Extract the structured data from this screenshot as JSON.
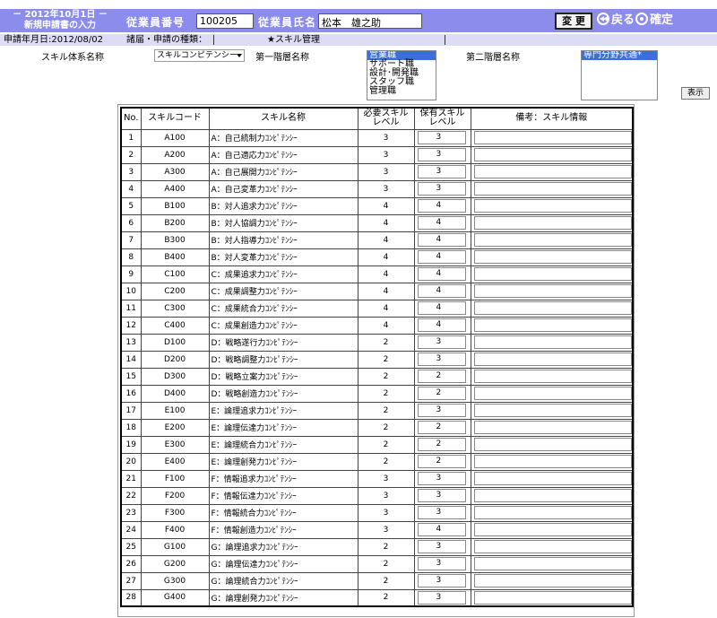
{
  "header": {
    "date": "－ 2012年10月1日 －",
    "screen_title": "新規申請書の入力",
    "employee_no_label": "従業員番号",
    "employee_no_value": "100205",
    "employee_name_label": "従業員氏名",
    "employee_name_value": "松本　雄之助",
    "change_button": "変 更",
    "back_label": "戻る",
    "confirm_label": "確定"
  },
  "subbar": {
    "apply_date": "申請年月日:2012/08/02",
    "type_label": "諸届・申請の種類：",
    "type_value": "★スキル管理"
  },
  "filters": {
    "system_label": "スキル体系名称",
    "system_selected": "スキルコンピテンシー",
    "level1_label": "第一階層名称",
    "level1_options": [
      "営業職",
      "サポート職",
      "設計･開発職",
      "スタッフ職",
      "管理職"
    ],
    "level2_label": "第二階層名称",
    "level2_options": [
      "専門分野共通*"
    ],
    "show_button": "表示"
  },
  "table": {
    "headers": {
      "no": "No.",
      "code": "スキルコード",
      "name": "スキル名称",
      "required_l1": "必要スキル",
      "required_l2": "レベル",
      "held_l1": "保有スキル",
      "held_l2": "レベル",
      "note": "備考：スキル情報"
    },
    "rows": [
      {
        "no": "1",
        "code": "A100",
        "name": "A：自己統制力ｺﾝﾋﾟﾃﾝｼｰ",
        "req": "3",
        "held": "3"
      },
      {
        "no": "2",
        "code": "A200",
        "name": "A：自己適応力ｺﾝﾋﾟﾃﾝｼｰ",
        "req": "3",
        "held": "3"
      },
      {
        "no": "3",
        "code": "A300",
        "name": "A：自己展開力ｺﾝﾋﾟﾃﾝｼｰ",
        "req": "3",
        "held": "3"
      },
      {
        "no": "4",
        "code": "A400",
        "name": "A：自己変革力ｺﾝﾋﾟﾃﾝｼｰ",
        "req": "3",
        "held": "3"
      },
      {
        "no": "5",
        "code": "B100",
        "name": "B：対人追求力ｺﾝﾋﾟﾃﾝｼｰ",
        "req": "4",
        "held": "4"
      },
      {
        "no": "6",
        "code": "B200",
        "name": "B：対人協調力ｺﾝﾋﾟﾃﾝｼｰ",
        "req": "4",
        "held": "4"
      },
      {
        "no": "7",
        "code": "B300",
        "name": "B：対人指導力ｺﾝﾋﾟﾃﾝｼｰ",
        "req": "4",
        "held": "4"
      },
      {
        "no": "8",
        "code": "B400",
        "name": "B：対人変革力ｺﾝﾋﾟﾃﾝｼｰ",
        "req": "4",
        "held": "4"
      },
      {
        "no": "9",
        "code": "C100",
        "name": "C：成果追求力ｺﾝﾋﾟﾃﾝｼｰ",
        "req": "4",
        "held": "4"
      },
      {
        "no": "10",
        "code": "C200",
        "name": "C：成果調整力ｺﾝﾋﾟﾃﾝｼｰ",
        "req": "4",
        "held": "4"
      },
      {
        "no": "11",
        "code": "C300",
        "name": "C：成果統合力ｺﾝﾋﾟﾃﾝｼｰ",
        "req": "4",
        "held": "4"
      },
      {
        "no": "12",
        "code": "C400",
        "name": "C：成果創造力ｺﾝﾋﾟﾃﾝｼｰ",
        "req": "4",
        "held": "4"
      },
      {
        "no": "13",
        "code": "D100",
        "name": "D：戦略遂行力ｺﾝﾋﾟﾃﾝｼｰ",
        "req": "2",
        "held": "3"
      },
      {
        "no": "14",
        "code": "D200",
        "name": "D：戦略調整力ｺﾝﾋﾟﾃﾝｼｰ",
        "req": "2",
        "held": "3"
      },
      {
        "no": "15",
        "code": "D300",
        "name": "D：戦略立案力ｺﾝﾋﾟﾃﾝｼｰ",
        "req": "2",
        "held": "2"
      },
      {
        "no": "16",
        "code": "D400",
        "name": "D：戦略創造力ｺﾝﾋﾟﾃﾝｼｰ",
        "req": "2",
        "held": "2"
      },
      {
        "no": "17",
        "code": "E100",
        "name": "E：論理追求力ｺﾝﾋﾟﾃﾝｼｰ",
        "req": "2",
        "held": "3"
      },
      {
        "no": "18",
        "code": "E200",
        "name": "E：論理伝達力ｺﾝﾋﾟﾃﾝｼｰ",
        "req": "2",
        "held": "2"
      },
      {
        "no": "19",
        "code": "E300",
        "name": "E：論理統合力ｺﾝﾋﾟﾃﾝｼｰ",
        "req": "2",
        "held": "2"
      },
      {
        "no": "20",
        "code": "E400",
        "name": "E：論理創発力ｺﾝﾋﾟﾃﾝｼｰ",
        "req": "2",
        "held": "2"
      },
      {
        "no": "21",
        "code": "F100",
        "name": "F：情報追求力ｺﾝﾋﾟﾃﾝｼｰ",
        "req": "3",
        "held": "3"
      },
      {
        "no": "22",
        "code": "F200",
        "name": "F：情報伝達力ｺﾝﾋﾟﾃﾝｼｰ",
        "req": "3",
        "held": "3"
      },
      {
        "no": "23",
        "code": "F300",
        "name": "F：情報統合力ｺﾝﾋﾟﾃﾝｼｰ",
        "req": "3",
        "held": "3"
      },
      {
        "no": "24",
        "code": "F400",
        "name": "F：情報創造力ｺﾝﾋﾟﾃﾝｼｰ",
        "req": "3",
        "held": "4"
      },
      {
        "no": "25",
        "code": "G100",
        "name": "G：論理追求力ｺﾝﾋﾟﾃﾝｼｰ",
        "req": "2",
        "held": "3"
      },
      {
        "no": "26",
        "code": "G200",
        "name": "G：論理伝達力ｺﾝﾋﾟﾃﾝｼｰ",
        "req": "2",
        "held": "3"
      },
      {
        "no": "27",
        "code": "G300",
        "name": "G：論理統合力ｺﾝﾋﾟﾃﾝｼｰ",
        "req": "2",
        "held": "3"
      },
      {
        "no": "28",
        "code": "G400",
        "name": "G：論理創発力ｺﾝﾋﾟﾃﾝｼｰ",
        "req": "2",
        "held": "3"
      }
    ]
  },
  "colors": {
    "header_bg": "#8c8cec",
    "subbar_bg": "#dcdcf4",
    "list_selected": "#3a70d8"
  }
}
